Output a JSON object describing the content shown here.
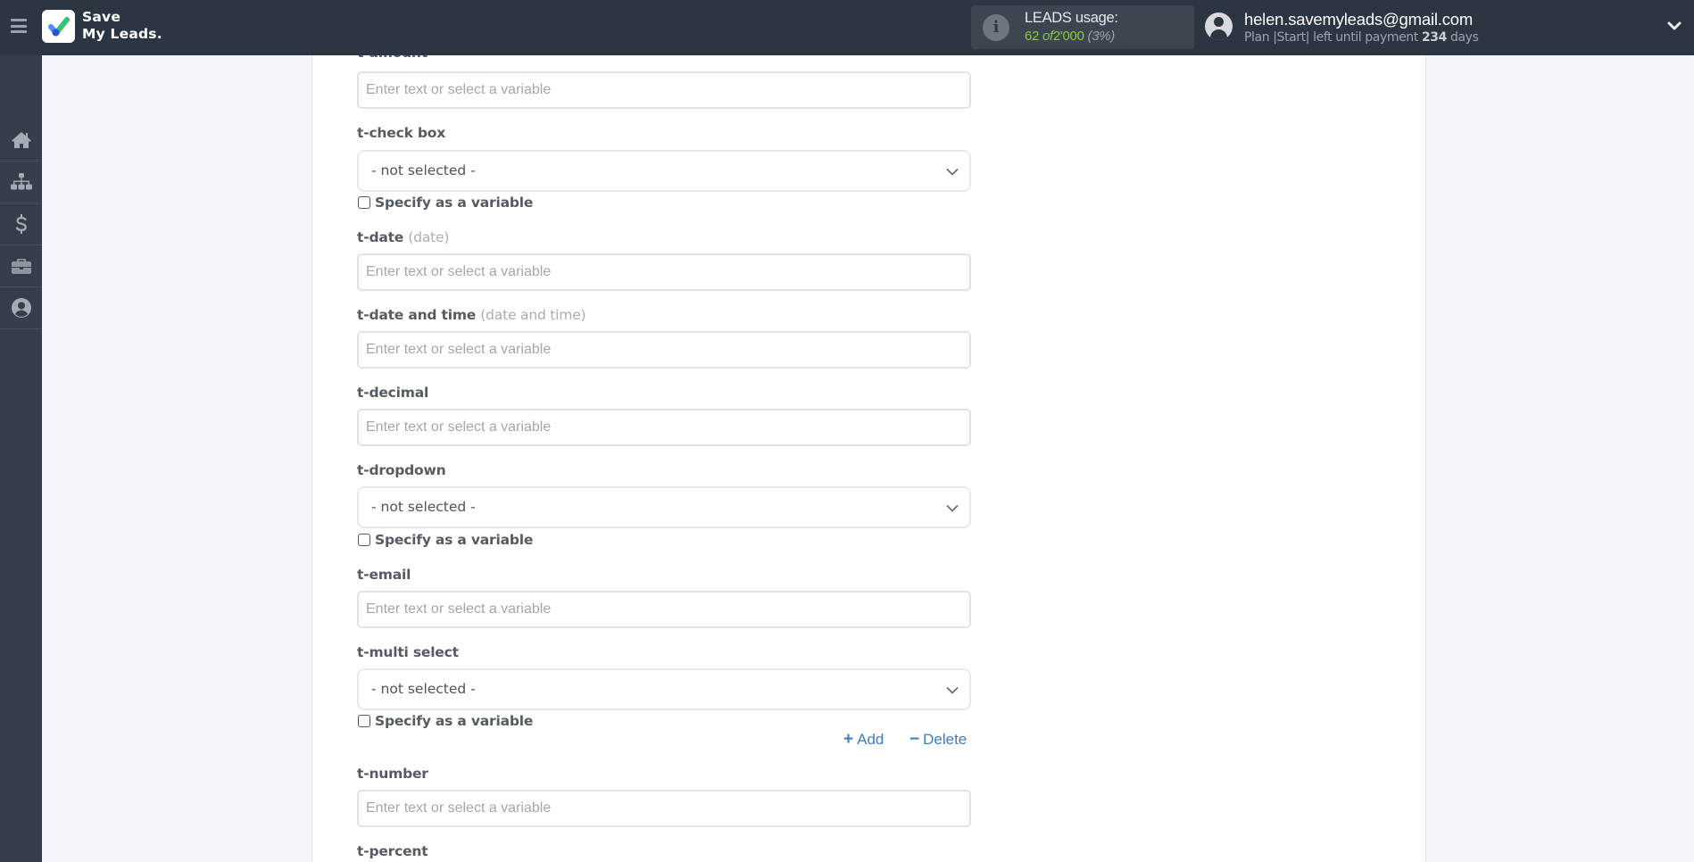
{
  "header": {
    "logo_line1": "Save",
    "logo_line2": "My Leads.",
    "usage": {
      "title": "LEADS usage:",
      "used": "62",
      "of_label": "of",
      "limit": "2'000",
      "percent": "(3%)",
      "fraction": 0.03
    },
    "user": {
      "email": "helen.savemyleads@gmail.com",
      "plan_prefix": "Plan |Start| left until payment ",
      "days": "234",
      "days_suffix": " days"
    }
  },
  "sidebar": {
    "items": [
      {
        "name": "home",
        "icon": "home-icon"
      },
      {
        "name": "connections",
        "icon": "sitemap-icon"
      },
      {
        "name": "billing",
        "icon": "dollar-icon"
      },
      {
        "name": "tools",
        "icon": "briefcase-icon"
      },
      {
        "name": "account",
        "icon": "user-circle-icon"
      }
    ]
  },
  "form": {
    "placeholder": "Enter text or select a variable",
    "not_selected": "- not selected -",
    "specify_variable": "Specify as a variable",
    "add_label": "Add",
    "delete_label": "Delete",
    "fields": {
      "amount": {
        "label": "t-amount",
        "type": "input",
        "value": ""
      },
      "check_box": {
        "label": "t-check box",
        "type": "select",
        "selected": "- not selected -",
        "specify_as_variable": false
      },
      "date": {
        "label": "t-date",
        "hint": "(date)",
        "type": "input",
        "value": ""
      },
      "date_time": {
        "label": "t-date and time",
        "hint": "(date and time)",
        "type": "input",
        "value": ""
      },
      "decimal": {
        "label": "t-decimal",
        "type": "input",
        "value": ""
      },
      "dropdown": {
        "label": "t-dropdown",
        "type": "select",
        "selected": "- not selected -",
        "specify_as_variable": false
      },
      "email": {
        "label": "t-email",
        "type": "input",
        "value": ""
      },
      "multi_select": {
        "label": "t-multi select",
        "type": "select",
        "selected": "- not selected -",
        "specify_as_variable": false
      },
      "number": {
        "label": "t-number",
        "type": "input",
        "value": ""
      },
      "percent": {
        "label": "t-percent",
        "type": "input",
        "value": ""
      }
    }
  }
}
